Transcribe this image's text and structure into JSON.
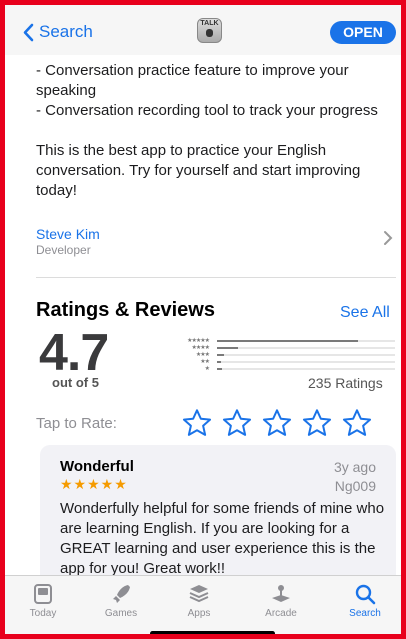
{
  "nav": {
    "back_label": "Search",
    "app_icon_text": "TALK",
    "open_label": "OPEN"
  },
  "description": {
    "lines": [
      "- Conversation practice feature to improve your speaking",
      "- Conversation recording tool to track your progress",
      "This is the best app to practice your English conversation.  Try for yourself and start improving today!"
    ]
  },
  "developer": {
    "name": "Steve Kim",
    "role": "Developer"
  },
  "ratings": {
    "title": "Ratings & Reviews",
    "see_all": "See All",
    "average": "4.7",
    "out_of": "out of 5",
    "count": "235 Ratings",
    "distribution": [
      {
        "stars": "★★★★★",
        "fraction": 0.79
      },
      {
        "stars": "★★★★",
        "fraction": 0.12
      },
      {
        "stars": "★★★",
        "fraction": 0.04
      },
      {
        "stars": "★★",
        "fraction": 0.02
      },
      {
        "stars": "★",
        "fraction": 0.03
      }
    ]
  },
  "tap_to_rate": {
    "label": "Tap to Rate:"
  },
  "review": {
    "title": "Wonderful",
    "date": "3y ago",
    "stars": "★★★★★",
    "author": "Ng009",
    "text": "Wonderfully helpful for some friends of mine who are learning English. If you are looking for a GREAT learning and user experience this is the app for you! Great work!!"
  },
  "tabs": [
    {
      "label": "Today",
      "icon": "today-icon"
    },
    {
      "label": "Games",
      "icon": "rocket-icon"
    },
    {
      "label": "Apps",
      "icon": "stack-icon"
    },
    {
      "label": "Arcade",
      "icon": "joystick-icon"
    },
    {
      "label": "Search",
      "icon": "search-icon"
    }
  ],
  "colors": {
    "accent": "#1a73e8",
    "star_orange": "#f59b00",
    "frame_red": "#e8001c"
  }
}
